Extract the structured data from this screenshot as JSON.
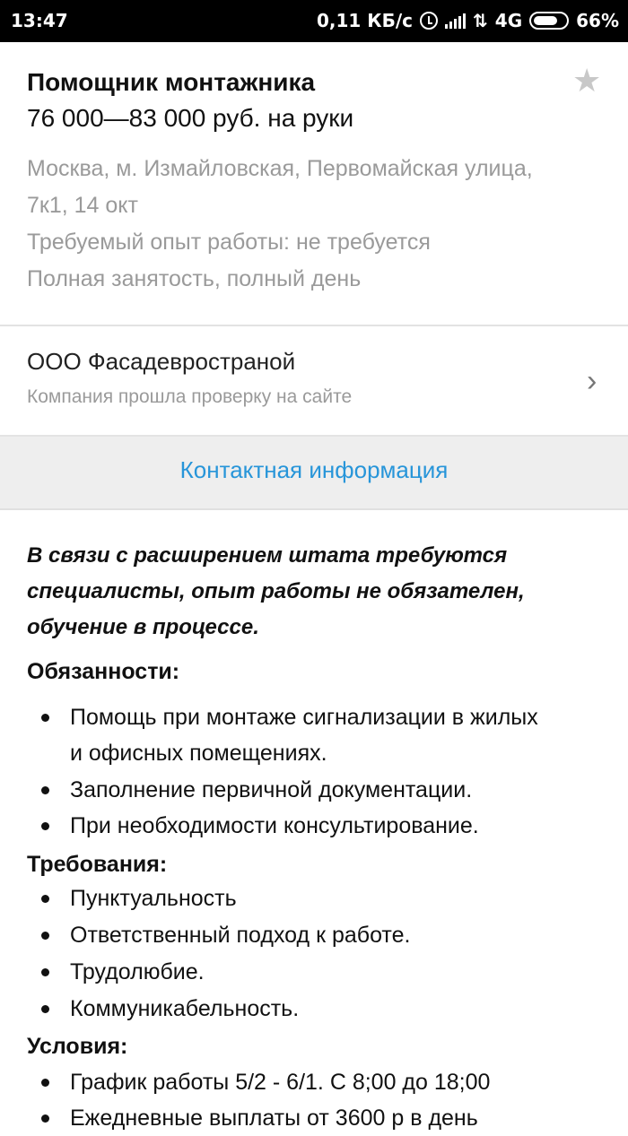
{
  "status_bar": {
    "time": "13:47",
    "speed": "0,11 КБ/с",
    "network": "4G",
    "battery": "66%",
    "icons": [
      "alarm-icon",
      "signal-icon",
      "data-arrows-icon",
      "battery-icon"
    ]
  },
  "vacancy": {
    "title": "Помощник монтажника",
    "salary": "76 000—83 000 руб. на руки",
    "address_line1": "Москва, м. Измайловская, Первомайская улица,",
    "address_line2": "7к1, 14 окт",
    "experience": "Требуемый опыт работы: не требуется",
    "employment": "Полная занятость, полный день",
    "favorite_icon": "star-icon"
  },
  "company": {
    "name": "ООО Фасадевространой",
    "verified_text": "Компания прошла проверку на сайте"
  },
  "contact": {
    "label": "Контактная информация",
    "color": "#2795d9"
  },
  "description": {
    "intro_lines": [
      "В связи с расширением штата требуются",
      "специалисты, опыт работы не обязателен,",
      "обучение в процессе."
    ],
    "duties_heading": "Обязанности:",
    "duties": [
      [
        "Помощь при монтаже сигнализации в жилых",
        "и офисных помещениях."
      ],
      [
        "Заполнение первичной документации."
      ],
      [
        "При необходимости консультирование."
      ]
    ],
    "requirements_heading": "Требования:",
    "requirements": [
      "Пунктуальность",
      "Ответственный подход к работе.",
      "Трудолюбие.",
      "Коммуникабельность."
    ],
    "conditions_heading": "Условия:",
    "conditions": [
      "График работы 5/2 - 6/1. С 8;00 до 18;00",
      "Ежедневные выплаты от 3600 р в день"
    ]
  }
}
